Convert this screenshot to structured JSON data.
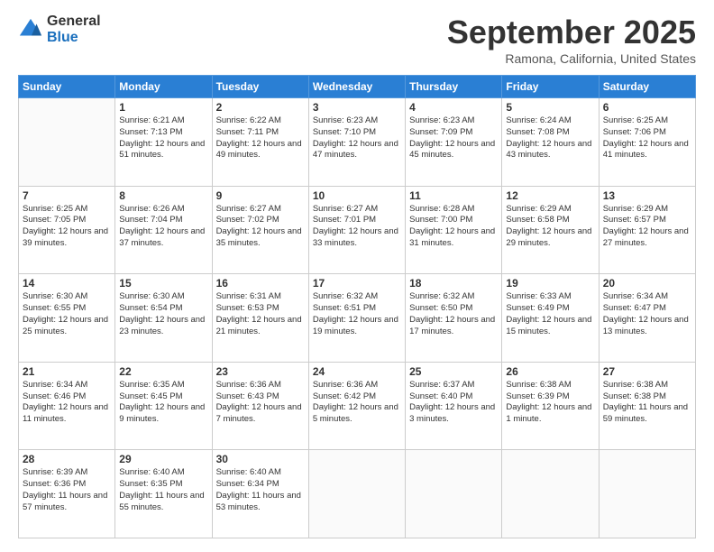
{
  "logo": {
    "general": "General",
    "blue": "Blue"
  },
  "header": {
    "month": "September 2025",
    "location": "Ramona, California, United States"
  },
  "weekdays": [
    "Sunday",
    "Monday",
    "Tuesday",
    "Wednesday",
    "Thursday",
    "Friday",
    "Saturday"
  ],
  "weeks": [
    [
      {
        "day": "",
        "sunrise": "",
        "sunset": "",
        "daylight": ""
      },
      {
        "day": "1",
        "sunrise": "Sunrise: 6:21 AM",
        "sunset": "Sunset: 7:13 PM",
        "daylight": "Daylight: 12 hours and 51 minutes."
      },
      {
        "day": "2",
        "sunrise": "Sunrise: 6:22 AM",
        "sunset": "Sunset: 7:11 PM",
        "daylight": "Daylight: 12 hours and 49 minutes."
      },
      {
        "day": "3",
        "sunrise": "Sunrise: 6:23 AM",
        "sunset": "Sunset: 7:10 PM",
        "daylight": "Daylight: 12 hours and 47 minutes."
      },
      {
        "day": "4",
        "sunrise": "Sunrise: 6:23 AM",
        "sunset": "Sunset: 7:09 PM",
        "daylight": "Daylight: 12 hours and 45 minutes."
      },
      {
        "day": "5",
        "sunrise": "Sunrise: 6:24 AM",
        "sunset": "Sunset: 7:08 PM",
        "daylight": "Daylight: 12 hours and 43 minutes."
      },
      {
        "day": "6",
        "sunrise": "Sunrise: 6:25 AM",
        "sunset": "Sunset: 7:06 PM",
        "daylight": "Daylight: 12 hours and 41 minutes."
      }
    ],
    [
      {
        "day": "7",
        "sunrise": "Sunrise: 6:25 AM",
        "sunset": "Sunset: 7:05 PM",
        "daylight": "Daylight: 12 hours and 39 minutes."
      },
      {
        "day": "8",
        "sunrise": "Sunrise: 6:26 AM",
        "sunset": "Sunset: 7:04 PM",
        "daylight": "Daylight: 12 hours and 37 minutes."
      },
      {
        "day": "9",
        "sunrise": "Sunrise: 6:27 AM",
        "sunset": "Sunset: 7:02 PM",
        "daylight": "Daylight: 12 hours and 35 minutes."
      },
      {
        "day": "10",
        "sunrise": "Sunrise: 6:27 AM",
        "sunset": "Sunset: 7:01 PM",
        "daylight": "Daylight: 12 hours and 33 minutes."
      },
      {
        "day": "11",
        "sunrise": "Sunrise: 6:28 AM",
        "sunset": "Sunset: 7:00 PM",
        "daylight": "Daylight: 12 hours and 31 minutes."
      },
      {
        "day": "12",
        "sunrise": "Sunrise: 6:29 AM",
        "sunset": "Sunset: 6:58 PM",
        "daylight": "Daylight: 12 hours and 29 minutes."
      },
      {
        "day": "13",
        "sunrise": "Sunrise: 6:29 AM",
        "sunset": "Sunset: 6:57 PM",
        "daylight": "Daylight: 12 hours and 27 minutes."
      }
    ],
    [
      {
        "day": "14",
        "sunrise": "Sunrise: 6:30 AM",
        "sunset": "Sunset: 6:55 PM",
        "daylight": "Daylight: 12 hours and 25 minutes."
      },
      {
        "day": "15",
        "sunrise": "Sunrise: 6:30 AM",
        "sunset": "Sunset: 6:54 PM",
        "daylight": "Daylight: 12 hours and 23 minutes."
      },
      {
        "day": "16",
        "sunrise": "Sunrise: 6:31 AM",
        "sunset": "Sunset: 6:53 PM",
        "daylight": "Daylight: 12 hours and 21 minutes."
      },
      {
        "day": "17",
        "sunrise": "Sunrise: 6:32 AM",
        "sunset": "Sunset: 6:51 PM",
        "daylight": "Daylight: 12 hours and 19 minutes."
      },
      {
        "day": "18",
        "sunrise": "Sunrise: 6:32 AM",
        "sunset": "Sunset: 6:50 PM",
        "daylight": "Daylight: 12 hours and 17 minutes."
      },
      {
        "day": "19",
        "sunrise": "Sunrise: 6:33 AM",
        "sunset": "Sunset: 6:49 PM",
        "daylight": "Daylight: 12 hours and 15 minutes."
      },
      {
        "day": "20",
        "sunrise": "Sunrise: 6:34 AM",
        "sunset": "Sunset: 6:47 PM",
        "daylight": "Daylight: 12 hours and 13 minutes."
      }
    ],
    [
      {
        "day": "21",
        "sunrise": "Sunrise: 6:34 AM",
        "sunset": "Sunset: 6:46 PM",
        "daylight": "Daylight: 12 hours and 11 minutes."
      },
      {
        "day": "22",
        "sunrise": "Sunrise: 6:35 AM",
        "sunset": "Sunset: 6:45 PM",
        "daylight": "Daylight: 12 hours and 9 minutes."
      },
      {
        "day": "23",
        "sunrise": "Sunrise: 6:36 AM",
        "sunset": "Sunset: 6:43 PM",
        "daylight": "Daylight: 12 hours and 7 minutes."
      },
      {
        "day": "24",
        "sunrise": "Sunrise: 6:36 AM",
        "sunset": "Sunset: 6:42 PM",
        "daylight": "Daylight: 12 hours and 5 minutes."
      },
      {
        "day": "25",
        "sunrise": "Sunrise: 6:37 AM",
        "sunset": "Sunset: 6:40 PM",
        "daylight": "Daylight: 12 hours and 3 minutes."
      },
      {
        "day": "26",
        "sunrise": "Sunrise: 6:38 AM",
        "sunset": "Sunset: 6:39 PM",
        "daylight": "Daylight: 12 hours and 1 minute."
      },
      {
        "day": "27",
        "sunrise": "Sunrise: 6:38 AM",
        "sunset": "Sunset: 6:38 PM",
        "daylight": "Daylight: 11 hours and 59 minutes."
      }
    ],
    [
      {
        "day": "28",
        "sunrise": "Sunrise: 6:39 AM",
        "sunset": "Sunset: 6:36 PM",
        "daylight": "Daylight: 11 hours and 57 minutes."
      },
      {
        "day": "29",
        "sunrise": "Sunrise: 6:40 AM",
        "sunset": "Sunset: 6:35 PM",
        "daylight": "Daylight: 11 hours and 55 minutes."
      },
      {
        "day": "30",
        "sunrise": "Sunrise: 6:40 AM",
        "sunset": "Sunset: 6:34 PM",
        "daylight": "Daylight: 11 hours and 53 minutes."
      },
      {
        "day": "",
        "sunrise": "",
        "sunset": "",
        "daylight": ""
      },
      {
        "day": "",
        "sunrise": "",
        "sunset": "",
        "daylight": ""
      },
      {
        "day": "",
        "sunrise": "",
        "sunset": "",
        "daylight": ""
      },
      {
        "day": "",
        "sunrise": "",
        "sunset": "",
        "daylight": ""
      }
    ]
  ]
}
